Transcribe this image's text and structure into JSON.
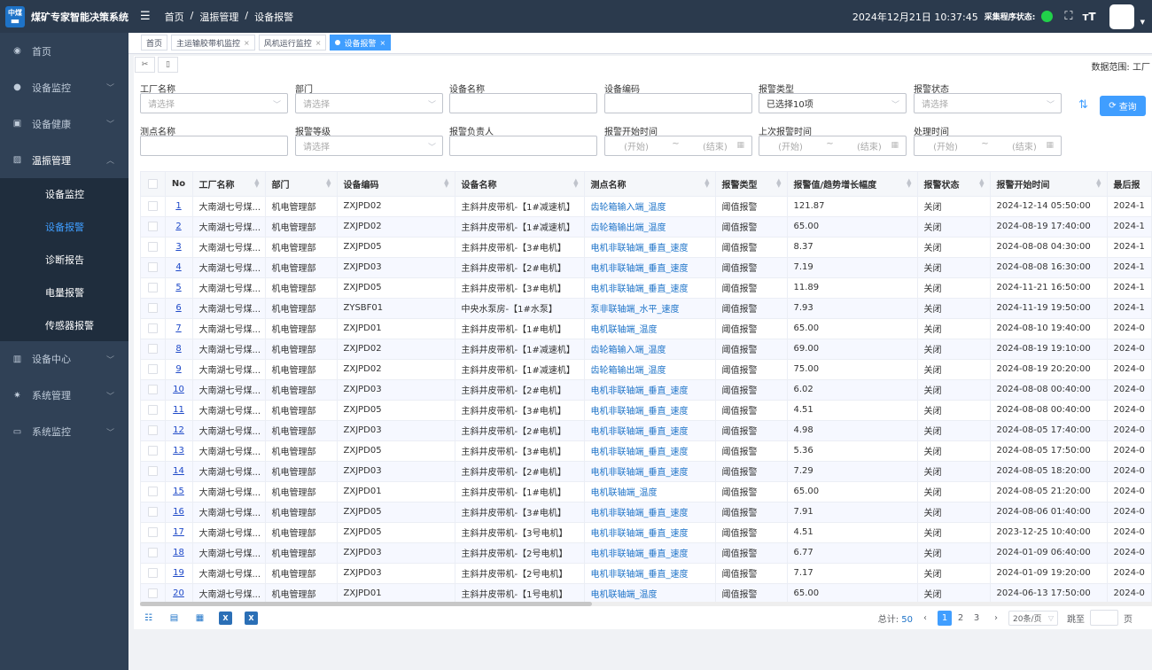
{
  "app": {
    "logo_text_top": "中煤",
    "logo_text_bottom": "",
    "title": "煤矿专家智能决策系统"
  },
  "sidebar": {
    "items": [
      {
        "label": "首页",
        "icon": "dashboard-icon",
        "has_children": false
      },
      {
        "label": "设备监控",
        "icon": "monitor-icon",
        "has_children": true
      },
      {
        "label": "设备健康",
        "icon": "health-icon",
        "has_children": true
      },
      {
        "label": "温振管理",
        "icon": "chart-icon",
        "has_children": true,
        "open": true
      }
    ],
    "submenu": [
      {
        "label": "设备监控",
        "active": false
      },
      {
        "label": "设备报警",
        "active": true
      },
      {
        "label": "诊断报告",
        "active": false
      },
      {
        "label": "电量报警",
        "active": false
      },
      {
        "label": "传感器报警",
        "active": false
      }
    ],
    "items_after": [
      {
        "label": "设备中心",
        "icon": "device-icon",
        "has_children": true
      },
      {
        "label": "系统管理",
        "icon": "gear-icon",
        "has_children": true
      },
      {
        "label": "系统监控",
        "icon": "screen-icon",
        "has_children": true
      }
    ]
  },
  "header": {
    "breadcrumb": [
      "首页",
      "温振管理",
      "设备报警"
    ],
    "separator": "/",
    "datetime": "2024年12月21日 10:37:45",
    "status_label": "采集程序状态:",
    "status_color": "#21d14a"
  },
  "tabs": [
    {
      "label": "首页",
      "closable": false,
      "active": false
    },
    {
      "label": "主运输胶带机监控",
      "closable": true,
      "active": false
    },
    {
      "label": "风机运行监控",
      "closable": true,
      "active": false
    },
    {
      "label": "设备报警",
      "closable": true,
      "active": true
    }
  ],
  "range_label": "数据范围: 工厂",
  "filters": [
    {
      "label": "工厂名称",
      "type": "select",
      "placeholder": "请选择",
      "value": ""
    },
    {
      "label": "部门",
      "type": "select",
      "placeholder": "请选择",
      "value": ""
    },
    {
      "label": "设备名称",
      "type": "input",
      "placeholder": "",
      "value": ""
    },
    {
      "label": "设备编码",
      "type": "input",
      "placeholder": "",
      "value": ""
    },
    {
      "label": "报警类型",
      "type": "select",
      "placeholder": "",
      "value": "已选择10项"
    },
    {
      "label": "报警状态",
      "type": "select",
      "placeholder": "请选择",
      "value": ""
    },
    {
      "label": "测点名称",
      "type": "input",
      "placeholder": "",
      "value": ""
    },
    {
      "label": "报警等级",
      "type": "select",
      "placeholder": "请选择",
      "value": ""
    },
    {
      "label": "报警负责人",
      "type": "input",
      "placeholder": "",
      "value": ""
    },
    {
      "label": "报警开始时间",
      "type": "range",
      "start": "(开始)",
      "sep": "~",
      "end": "(结束)"
    },
    {
      "label": "上次报警时间",
      "type": "range",
      "start": "(开始)",
      "sep": "~",
      "end": "(结束)"
    },
    {
      "label": "处理时间",
      "type": "range",
      "start": "(开始)",
      "sep": "~",
      "end": "(结束)"
    }
  ],
  "query_button": "查询",
  "table": {
    "columns": [
      "No",
      "工厂名称",
      "部门",
      "设备编码",
      "设备名称",
      "测点名称",
      "报警类型",
      "报警值/趋势增长幅度",
      "报警状态",
      "报警开始时间",
      "最后报"
    ],
    "rows": [
      [
        "1",
        "大南湖七号煤...",
        "机电管理部",
        "ZXJPD02",
        "主斜井皮带机-【1#减速机】",
        "齿轮箱输入端_温度",
        "阈值报警",
        "121.87",
        "关闭",
        "2024-12-14 05:50:00",
        "2024-1"
      ],
      [
        "2",
        "大南湖七号煤...",
        "机电管理部",
        "ZXJPD02",
        "主斜井皮带机-【1#减速机】",
        "齿轮箱输出端_温度",
        "阈值报警",
        "65.00",
        "关闭",
        "2024-08-19 17:40:00",
        "2024-1"
      ],
      [
        "3",
        "大南湖七号煤...",
        "机电管理部",
        "ZXJPD05",
        "主斜井皮带机-【3#电机】",
        "电机非联轴端_垂直_速度",
        "阈值报警",
        "8.37",
        "关闭",
        "2024-08-08 04:30:00",
        "2024-1"
      ],
      [
        "4",
        "大南湖七号煤...",
        "机电管理部",
        "ZXJPD03",
        "主斜井皮带机-【2#电机】",
        "电机非联轴端_垂直_速度",
        "阈值报警",
        "7.19",
        "关闭",
        "2024-08-08 16:30:00",
        "2024-1"
      ],
      [
        "5",
        "大南湖七号煤...",
        "机电管理部",
        "ZXJPD05",
        "主斜井皮带机-【3#电机】",
        "电机非联轴端_垂直_速度",
        "阈值报警",
        "11.89",
        "关闭",
        "2024-11-21 16:50:00",
        "2024-1"
      ],
      [
        "6",
        "大南湖七号煤...",
        "机电管理部",
        "ZYSBF01",
        "中央水泵房-【1#水泵】",
        "泵非联轴端_水平_速度",
        "阈值报警",
        "7.93",
        "关闭",
        "2024-11-19 19:50:00",
        "2024-1"
      ],
      [
        "7",
        "大南湖七号煤...",
        "机电管理部",
        "ZXJPD01",
        "主斜井皮带机-【1#电机】",
        "电机联轴端_温度",
        "阈值报警",
        "65.00",
        "关闭",
        "2024-08-10 19:40:00",
        "2024-0"
      ],
      [
        "8",
        "大南湖七号煤...",
        "机电管理部",
        "ZXJPD02",
        "主斜井皮带机-【1#减速机】",
        "齿轮箱输入端_温度",
        "阈值报警",
        "69.00",
        "关闭",
        "2024-08-19 19:10:00",
        "2024-0"
      ],
      [
        "9",
        "大南湖七号煤...",
        "机电管理部",
        "ZXJPD02",
        "主斜井皮带机-【1#减速机】",
        "齿轮箱输出端_温度",
        "阈值报警",
        "75.00",
        "关闭",
        "2024-08-19 20:20:00",
        "2024-0"
      ],
      [
        "10",
        "大南湖七号煤...",
        "机电管理部",
        "ZXJPD03",
        "主斜井皮带机-【2#电机】",
        "电机非联轴端_垂直_速度",
        "阈值报警",
        "6.02",
        "关闭",
        "2024-08-08 00:40:00",
        "2024-0"
      ],
      [
        "11",
        "大南湖七号煤...",
        "机电管理部",
        "ZXJPD05",
        "主斜井皮带机-【3#电机】",
        "电机非联轴端_垂直_速度",
        "阈值报警",
        "4.51",
        "关闭",
        "2024-08-08 00:40:00",
        "2024-0"
      ],
      [
        "12",
        "大南湖七号煤...",
        "机电管理部",
        "ZXJPD03",
        "主斜井皮带机-【2#电机】",
        "电机非联轴端_垂直_速度",
        "阈值报警",
        "4.98",
        "关闭",
        "2024-08-05 17:40:00",
        "2024-0"
      ],
      [
        "13",
        "大南湖七号煤...",
        "机电管理部",
        "ZXJPD05",
        "主斜井皮带机-【3#电机】",
        "电机非联轴端_垂直_速度",
        "阈值报警",
        "5.36",
        "关闭",
        "2024-08-05 17:50:00",
        "2024-0"
      ],
      [
        "14",
        "大南湖七号煤...",
        "机电管理部",
        "ZXJPD03",
        "主斜井皮带机-【2#电机】",
        "电机非联轴端_垂直_速度",
        "阈值报警",
        "7.29",
        "关闭",
        "2024-08-05 18:20:00",
        "2024-0"
      ],
      [
        "15",
        "大南湖七号煤...",
        "机电管理部",
        "ZXJPD01",
        "主斜井皮带机-【1#电机】",
        "电机联轴端_温度",
        "阈值报警",
        "65.00",
        "关闭",
        "2024-08-05 21:20:00",
        "2024-0"
      ],
      [
        "16",
        "大南湖七号煤...",
        "机电管理部",
        "ZXJPD05",
        "主斜井皮带机-【3#电机】",
        "电机非联轴端_垂直_速度",
        "阈值报警",
        "7.91",
        "关闭",
        "2024-08-06 01:40:00",
        "2024-0"
      ],
      [
        "17",
        "大南湖七号煤...",
        "机电管理部",
        "ZXJPD05",
        "主斜井皮带机-【3号电机】",
        "电机非联轴端_垂直_速度",
        "阈值报警",
        "4.51",
        "关闭",
        "2023-12-25 10:40:00",
        "2024-0"
      ],
      [
        "18",
        "大南湖七号煤...",
        "机电管理部",
        "ZXJPD03",
        "主斜井皮带机-【2号电机】",
        "电机非联轴端_垂直_速度",
        "阈值报警",
        "6.77",
        "关闭",
        "2024-01-09 06:40:00",
        "2024-0"
      ],
      [
        "19",
        "大南湖七号煤...",
        "机电管理部",
        "ZXJPD03",
        "主斜井皮带机-【2号电机】",
        "电机非联轴端_垂直_速度",
        "阈值报警",
        "7.17",
        "关闭",
        "2024-01-09 19:20:00",
        "2024-0"
      ],
      [
        "20",
        "大南湖七号煤...",
        "机电管理部",
        "ZXJPD01",
        "主斜井皮带机-【1号电机】",
        "电机联轴端_温度",
        "阈值报警",
        "65.00",
        "关闭",
        "2024-06-13 17:50:00",
        "2024-0"
      ]
    ]
  },
  "pagination": {
    "total_label": "总计:",
    "total": "50",
    "pages": [
      "1",
      "2",
      "3"
    ],
    "current": "1",
    "prev": "‹",
    "next": "›",
    "page_size": "20条/页",
    "jump_label": "跳至",
    "page_suffix": "页"
  }
}
